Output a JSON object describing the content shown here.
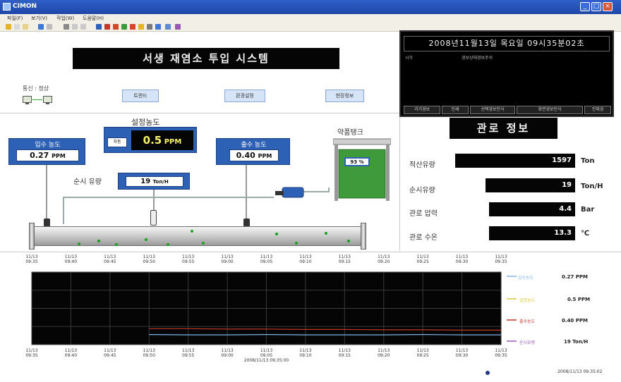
{
  "window": {
    "title": "CIMON"
  },
  "menu": [
    "파일(F)",
    "보기(V)",
    "작업(W)",
    "도움말(H)"
  ],
  "system_title": "서생 재염소 투입 시스템",
  "comm_status": "통신 : 정상",
  "nav_buttons": [
    "트렌드",
    "환경설정",
    "현장정보"
  ],
  "clock": "2008년11월13일   목요일   09시35분02초",
  "alarm_headers": [
    "시각",
    "경보상태",
    "경보주석"
  ],
  "alarm_tabs": [
    "과거경보",
    "인쇄",
    "선택경보인식",
    "화면경보인식",
    "전체경"
  ],
  "setpoint": {
    "label": "설정농도",
    "mode": "자동",
    "value": "0.5",
    "unit": "PPM"
  },
  "inflow_conc": {
    "label": "입수 농도",
    "value": "0.27",
    "unit": "PPM"
  },
  "outflow_conc": {
    "label": "출수 농도",
    "value": "0.40",
    "unit": "PPM"
  },
  "instant_flow": {
    "label": "순시 유량",
    "value": "19",
    "unit": "Ton/H"
  },
  "tank": {
    "label": "약품탱크",
    "level_text": "93 %",
    "level_fraction": 0.93
  },
  "pipe_info": {
    "title": "관로 정보",
    "rows": [
      {
        "label": "적산유량",
        "value": "1597",
        "unit": "Ton"
      },
      {
        "label": "순시유량",
        "value": "19",
        "unit": "Ton/H"
      },
      {
        "label": "관로 압력",
        "value": "4.4",
        "unit": "Bar"
      },
      {
        "label": "관로 수온",
        "value": "13.3",
        "unit": "℃"
      }
    ]
  },
  "trend": {
    "time_labels": [
      "11/13 09:35",
      "11/13 09:40",
      "11/13 09:45",
      "11/13 09:50",
      "11/13 09:55",
      "11/13 09:00",
      "11/13 09:05",
      "11/13 09:10",
      "11/13 09:15",
      "11/13 09:20",
      "11/13 09:25",
      "11/13 09:30",
      "11/13 09:35"
    ],
    "center_time": "2008/11/13 09:35:00",
    "legend": [
      {
        "name": "입수농도",
        "value": "0.27 PPM",
        "color": "#7fb3e6"
      },
      {
        "name": "설정농도",
        "value": "0.5 PPM",
        "color": "#d8c73a"
      },
      {
        "name": "출수농도",
        "value": "0.40 PPM",
        "color": "#c0392b"
      },
      {
        "name": "순시유량",
        "value": "19  Ton/H",
        "color": "#9b59b6"
      }
    ]
  },
  "chart_data": {
    "type": "line",
    "x": [
      "09:35",
      "09:40",
      "09:45",
      "09:50",
      "09:55",
      "09:00",
      "09:05",
      "09:10",
      "09:15",
      "09:20",
      "09:25",
      "09:30",
      "09:35"
    ],
    "series": [
      {
        "name": "입수농도",
        "values": [
          null,
          null,
          null,
          0.28,
          0.27,
          0.27,
          0.28,
          0.27,
          0.27,
          0.27,
          0.28,
          0.27,
          0.27
        ]
      },
      {
        "name": "출수농도",
        "values": [
          null,
          null,
          null,
          0.44,
          0.44,
          0.43,
          0.43,
          0.42,
          0.42,
          0.41,
          0.41,
          0.4,
          0.4
        ]
      }
    ],
    "ylim": [
      0,
      2.0
    ],
    "grid": true
  },
  "status_time": "2008/11/13 09:35:02",
  "colors": {
    "panel_blue": "#2c61b6",
    "trend_bg": "#050505",
    "tank_green": "#3e9a3a"
  }
}
